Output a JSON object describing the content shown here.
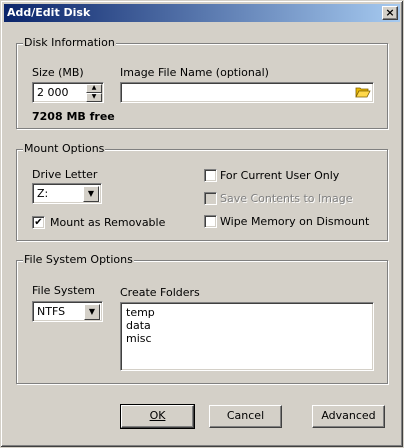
{
  "window": {
    "title": "Add/Edit Disk",
    "close_label": "×"
  },
  "disk_info": {
    "legend": "Disk Information",
    "size_label": "Size (MB)",
    "size_value": "2 000",
    "free_text": "7208 MB free",
    "image_label": "Image File Name (optional)",
    "image_value": ""
  },
  "mount": {
    "legend": "Mount Options",
    "drive_label": "Drive Letter",
    "drive_value": "Z:",
    "removable_label": "Mount as Removable",
    "removable_checked": "✔",
    "current_user_label": "For Current User Only",
    "save_contents_label": "Save Contents to Image",
    "wipe_label": "Wipe Memory on Dismount"
  },
  "fs": {
    "legend": "File System Options",
    "fs_label": "File System",
    "fs_value": "NTFS",
    "folders_label": "Create Folders",
    "folders": [
      "temp",
      "data",
      "misc"
    ]
  },
  "buttons": {
    "ok": "OK",
    "cancel": "Cancel",
    "advanced": "Advanced"
  },
  "icons": {
    "folder": "folder-open-icon",
    "dropdown": "chevron-down-icon",
    "spin_up": "triangle-up-icon",
    "spin_down": "triangle-down-icon",
    "close": "close-icon"
  }
}
